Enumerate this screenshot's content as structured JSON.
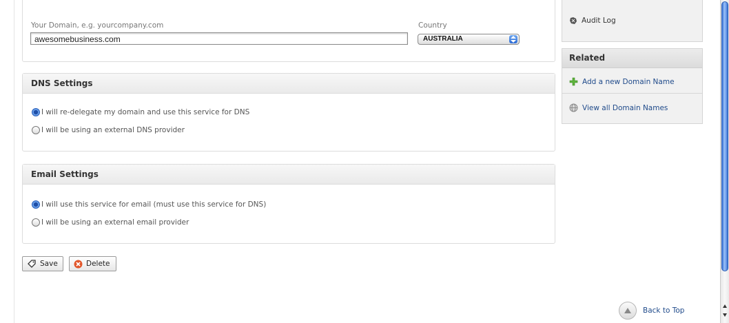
{
  "domain_form": {
    "domain_label": "Your Domain, e.g. yourcompany.com",
    "domain_value": "awesomebusiness.com",
    "country_label": "Country",
    "country_value": "AUSTRALIA"
  },
  "dns_settings": {
    "title": "DNS Settings",
    "options": [
      {
        "label": "I will re-delegate my domain and use this service for DNS",
        "selected": true
      },
      {
        "label": "I will be using an external DNS provider",
        "selected": false
      }
    ]
  },
  "email_settings": {
    "title": "Email Settings",
    "options": [
      {
        "label": "I will use this service for email (must use this service for DNS)",
        "selected": true
      },
      {
        "label": "I will be using an external email provider",
        "selected": false
      }
    ]
  },
  "actions": {
    "save_label": "Save",
    "delete_label": "Delete"
  },
  "sidebar": {
    "audit_log_label": "Audit Log",
    "related_title": "Related",
    "related_links": [
      {
        "label": "Add a new Domain Name",
        "icon": "plus-icon"
      },
      {
        "label": "View all Domain Names",
        "icon": "globe-icon"
      }
    ]
  },
  "footer": {
    "back_to_top_label": "Back to Top"
  },
  "colors": {
    "link": "#1f4a8a",
    "accent_blue": "#3a74d8",
    "add_green": "#5db33c",
    "delete_orange": "#e2562a"
  }
}
